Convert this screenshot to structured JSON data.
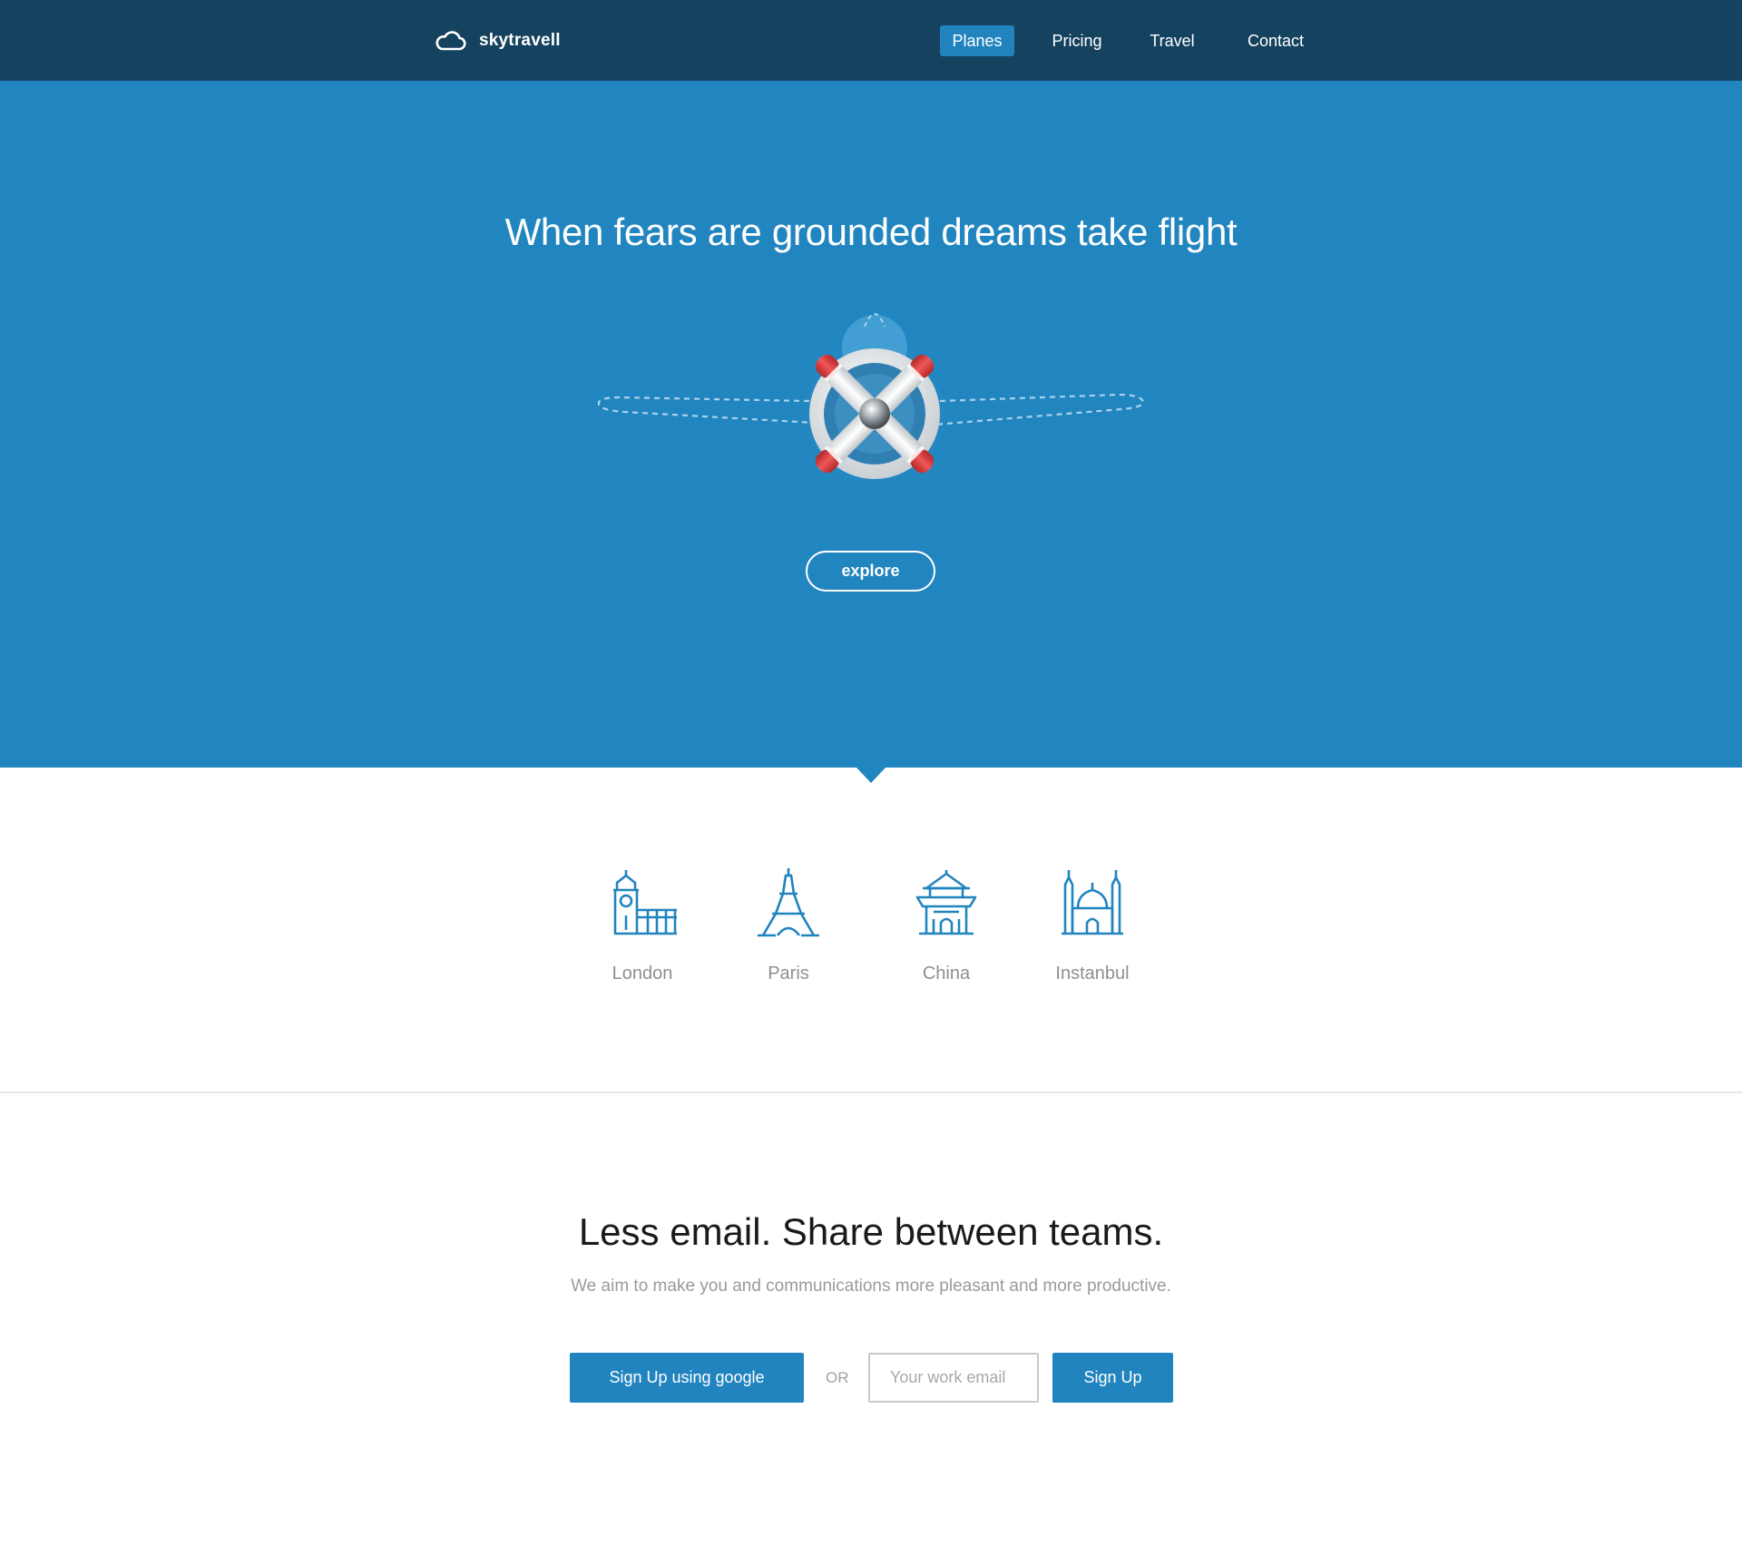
{
  "brand": {
    "name": "skytravell",
    "icon": "cloud-icon"
  },
  "nav": {
    "items": [
      {
        "label": "Planes",
        "active": true
      },
      {
        "label": "Pricing",
        "active": false
      },
      {
        "label": "Travel",
        "active": false
      },
      {
        "label": "Contact",
        "active": false
      }
    ]
  },
  "hero": {
    "title": "When fears are grounded dreams take flight",
    "illustration": "propeller-plane-icon",
    "button_label": "explore"
  },
  "destinations": [
    {
      "label": "London",
      "icon": "big-ben-icon"
    },
    {
      "label": "Paris",
      "icon": "eiffel-tower-icon"
    },
    {
      "label": "China",
      "icon": "pagoda-icon"
    },
    {
      "label": "Instanbul",
      "icon": "mosque-icon"
    }
  ],
  "signup": {
    "title": "Less email. Share between teams.",
    "subtitle": "We aim to make you and communications more pleasant and more productive.",
    "google_button": "Sign Up using google",
    "or_text": "OR",
    "email_placeholder": "Your work email",
    "submit_button": "Sign Up"
  },
  "colors": {
    "nav_bg": "#15425f",
    "hero_bg": "#2185bf",
    "accent": "#2184bf",
    "propeller_red": "#d83a3a"
  }
}
